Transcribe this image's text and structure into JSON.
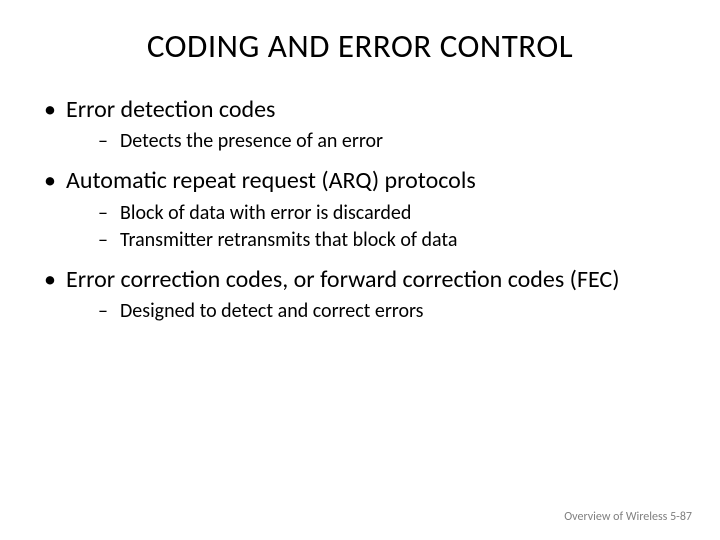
{
  "title": "CODING AND ERROR CONTROL",
  "bullets": [
    {
      "text": "Error detection codes",
      "sub": [
        "Detects the presence of an error"
      ]
    },
    {
      "text": "Automatic repeat request (ARQ) protocols",
      "sub": [
        "Block of data with error is discarded",
        "Transmitter retransmits that block of data"
      ]
    },
    {
      "text": "Error correction codes, or forward correction codes (FEC)",
      "sub": [
        "Designed to detect and correct errors"
      ]
    }
  ],
  "footer": "Overview of Wireless 5-87"
}
